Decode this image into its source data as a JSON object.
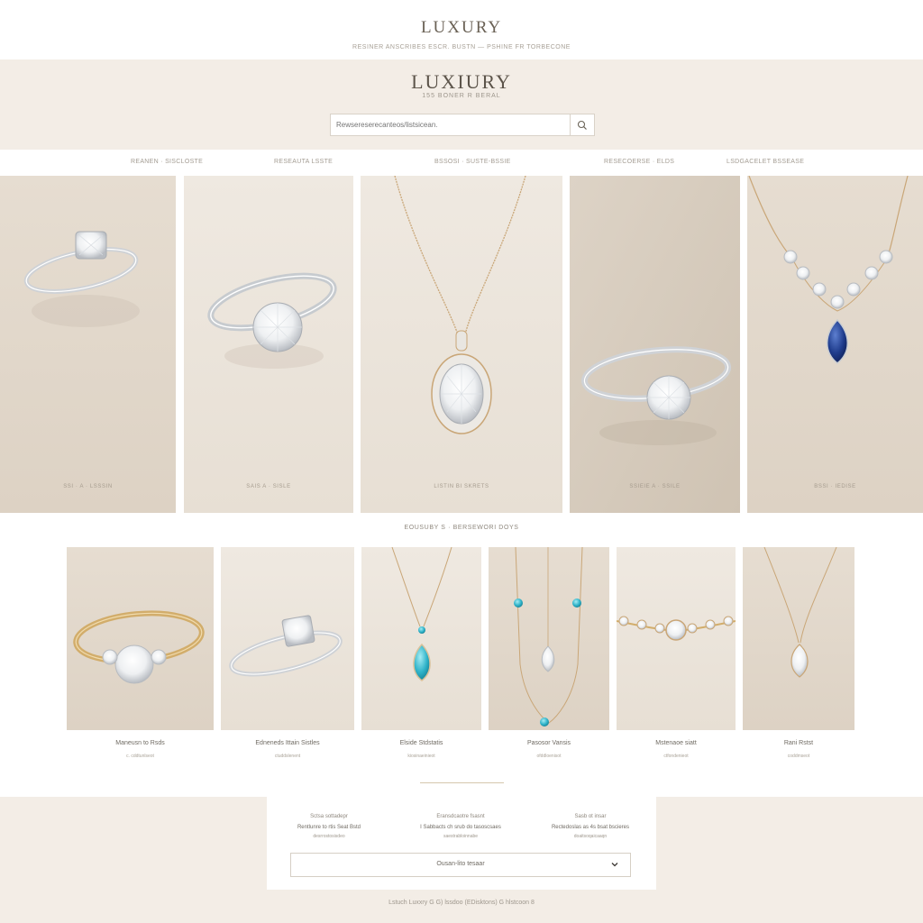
{
  "header": {
    "logo": "LUXURY",
    "nav": "RESINER   ANSCRIBES   ESCR. BUSTN  —  PSHINE FR TORBECONE"
  },
  "hero": {
    "logo": "LUXIURY",
    "tagline": "155 BONER R BERAL",
    "search_placeholder": "Rewsereserecanteos/listsicean."
  },
  "categories": [
    "REANEN · SISCLOSTE",
    "RESEAUTA LSSTE",
    "BSSOSI · SUSTE-BSSIE",
    "RESECOERSE · ELDS",
    "LSDGACELET BSSEASE"
  ],
  "featured": [
    {
      "caption": "SSI · A · LSSSIN",
      "kind": "solitaire-ring"
    },
    {
      "caption": "SAIS A · SISLE",
      "kind": "halo-ring"
    },
    {
      "caption": "LISTIN BI SKRETS",
      "kind": "oval-pendant"
    },
    {
      "caption": "SSIEIE A · SSILE",
      "kind": "pave-ring"
    },
    {
      "caption": "BSSI · IEDISE",
      "kind": "sapphire-necklace"
    }
  ],
  "section_label": "EOUSUBY S   ·   BERSEWORI DOYS",
  "products": [
    {
      "name": "Maneusn to Rsds",
      "sub": "c. cddtunlseot",
      "kind": "gold-ring"
    },
    {
      "name": "Edneneds Ittain Sistles",
      "sub": "ctuddslenent",
      "kind": "princess-ring"
    },
    {
      "name": "Elside Stdstatis",
      "sub": "kiosinaeinieot",
      "kind": "topaz-pendant"
    },
    {
      "name": "Pasosor Vansis",
      "sub": "ofddloenisot",
      "kind": "topaz-station"
    },
    {
      "name": "Mstenaoe siatt",
      "sub": "ctfondenieot",
      "kind": "bracelet"
    },
    {
      "name": "Rani Rstst",
      "sub": "coddmseot",
      "kind": "pear-pendant"
    }
  ],
  "footer": {
    "columns": [
      {
        "heading": "Sctsa sottadepr",
        "main": "Rentlunre to rtis Seat Bstd",
        "sub": "desrrostosisdeo"
      },
      {
        "heading": "Eransdcaotre fsasnt",
        "main": "I Sabbacts ch srub do tasoscsaes",
        "sub": "saestrabloinnabe"
      },
      {
        "heading": "Sasb ot insar",
        "main": "Rectedoslas as 4s bsat bscieres",
        "sub": "doaitsoqaicaaqn"
      }
    ],
    "select_label": "Ousan-lito tesaar",
    "copyright": "Lstuch Luxxry  G G)  lssdoo   (EDisktons)  G  hlstcoon  8"
  }
}
